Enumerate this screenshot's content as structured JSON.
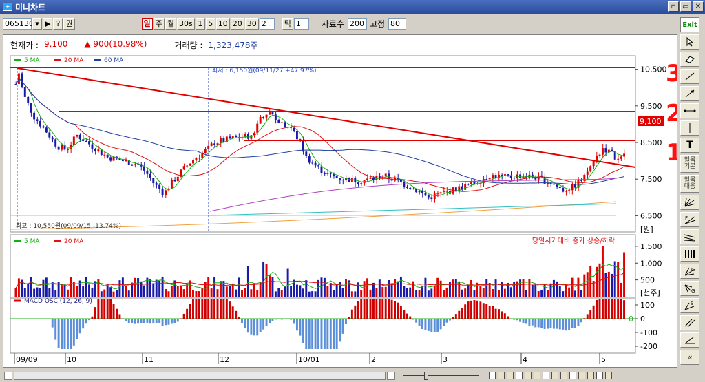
{
  "window": {
    "title": "미니차트",
    "app_icon_text": "+",
    "btn_restore": "▫",
    "btn_max": "▭",
    "btn_close": "✕"
  },
  "toolbar": {
    "code": "065130",
    "q_btn": "?",
    "right_btn": "▶",
    "kwon": "권",
    "periods": [
      "일",
      "주",
      "월",
      "30s",
      "1",
      "5",
      "10",
      "20",
      "30"
    ],
    "period_input": "2",
    "tick_label": "틱",
    "tick_input": "1",
    "count_label": "자료수",
    "count_value": "200",
    "fixed_label": "고정",
    "fixed_value": "80"
  },
  "info": {
    "price_label": "현재가 :",
    "price": "9,100",
    "change": "▲ 900(10.98%)",
    "volume_label": "거래량 :",
    "volume": "1,323,478주"
  },
  "price_legend": [
    "5 MA",
    "20 MA",
    "60 MA"
  ],
  "volume_legend": [
    "5 MA",
    "20 MA"
  ],
  "volume_note": "당일시가대비 증가 상승/하락",
  "macd_legend": "MACD OSC (12, 26, 9)",
  "annotations": {
    "high": "최저 : 6,150원(09/11/27,+47.97%)",
    "low": "최고 : 10,550원(09/09/15,-13.74%)",
    "current_price_tag": "9,100",
    "mark_3": "3",
    "mark_2": "2",
    "mark_1": "1"
  },
  "price_axis": [
    "10,500",
    "9,500",
    "8,500",
    "7,500",
    "6,500"
  ],
  "price_unit": "[원]",
  "volume_axis": [
    "1,500",
    "1,000",
    "500"
  ],
  "volume_unit": "[천주]",
  "macd_axis": [
    "100",
    "0",
    "-100",
    "-200"
  ],
  "macd_zero_label": "0",
  "date_axis": [
    "09/09",
    "10",
    "11",
    "12",
    "10/01",
    "2",
    "3",
    "4",
    "5"
  ],
  "palette": [
    {
      "name": "exit-button",
      "label": "Exit"
    },
    {
      "name": "pointer-icon",
      "label": ""
    },
    {
      "name": "eraser-icon",
      "label": ""
    },
    {
      "name": "trend-line-icon",
      "label": ""
    },
    {
      "name": "arrow-line-icon",
      "label": ""
    },
    {
      "name": "horizontal-line-icon",
      "label": ""
    },
    {
      "name": "vertical-line-icon",
      "label": ""
    },
    {
      "name": "text-tool-icon",
      "label": "T"
    },
    {
      "name": "basic-button",
      "label": "일목\n기본"
    },
    {
      "name": "follow-button",
      "label": "일목\n대응"
    },
    {
      "name": "fan-icon",
      "label": ""
    },
    {
      "name": "fibo-fan-icon",
      "label": ""
    },
    {
      "name": "channel-icon",
      "label": ""
    },
    {
      "name": "period-lines-icon",
      "label": ""
    },
    {
      "name": "gann-fan-icon",
      "label": ""
    },
    {
      "name": "gann-angle-icon",
      "label": ""
    },
    {
      "name": "speed-lines-icon",
      "label": ""
    },
    {
      "name": "parallel-icon",
      "label": ""
    },
    {
      "name": "angle-icon",
      "label": ""
    },
    {
      "name": "collapse-button",
      "label": "«"
    }
  ],
  "colors": {
    "up": "#e00000",
    "down": "#1a1aa8",
    "ma5": "#10b010",
    "ma20": "#e01010",
    "ma60": "#2040a0",
    "resistance": "#e00000"
  }
}
